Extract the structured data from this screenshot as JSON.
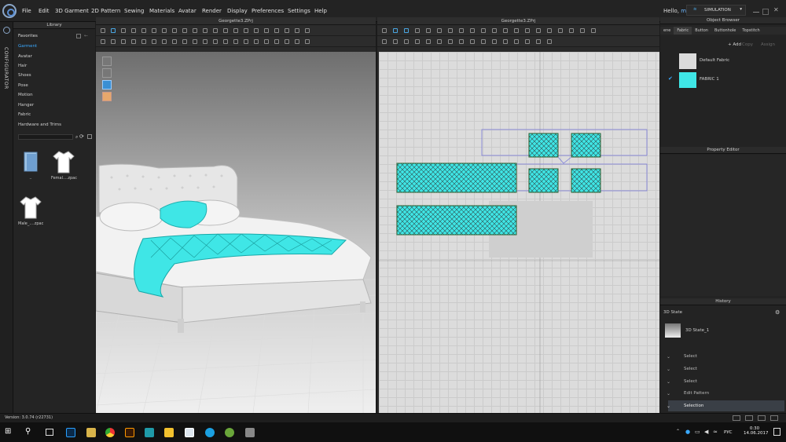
{
  "menu": {
    "items": [
      "File",
      "Edit",
      "3D Garment",
      "2D Pattern",
      "Sewing",
      "Materials",
      "Avatar",
      "Render",
      "Display",
      "Preferences",
      "Settings",
      "Help"
    ],
    "greeting": "Hello,",
    "username": "m3z",
    "mode": "SIMULATION"
  },
  "sidebar": {
    "vertical_label": "CONFIGURATOR"
  },
  "library": {
    "title": "Library",
    "items": [
      "Favorites",
      "Garment",
      "Avatar",
      "Hair",
      "Shoes",
      "Pose",
      "Motion",
      "Hanger",
      "Fabric",
      "Hardware and Trims"
    ],
    "files": [
      "..",
      "Femal....zpac",
      "Male_....zpac"
    ]
  },
  "viewport3d": {
    "title": "Georgette3.ZPrj"
  },
  "viewport2d": {
    "title": "Georgette3.ZPrj"
  },
  "object_browser": {
    "title": "Object Browser",
    "tabs": [
      "ene",
      "Fabric",
      "Button",
      "Buttonhole",
      "Topstitch"
    ],
    "add": "Add",
    "copy": "Copy",
    "assign": "Assign",
    "fabrics": [
      "Default Fabric",
      "FABRIC 1"
    ]
  },
  "property_editor": {
    "title": "Property Editor"
  },
  "history": {
    "title": "History",
    "state_label": "3D State",
    "state_item": "3D State_1",
    "entries": [
      "Select",
      "Select",
      "Select",
      "Edit Pattern",
      "Selection"
    ]
  },
  "status": {
    "version": "Version: 3.0.74",
    "build": "(r22731)"
  },
  "taskbar": {
    "lang": "РУС",
    "time": "0:30",
    "date": "14.06.2017"
  },
  "colors": {
    "fabric_cyan": "#3fe6e6",
    "accent_blue": "#4aa7e4"
  }
}
